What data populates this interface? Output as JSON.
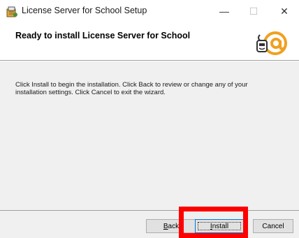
{
  "window": {
    "title": "License Server for School Setup",
    "minimize_glyph": "—",
    "maximize_glyph": "☐",
    "close_glyph": "✕"
  },
  "header": {
    "heading": "Ready to install License Server for School",
    "logo_icon": "at-sign-logo-icon"
  },
  "body": {
    "description": "Click Install to begin the installation. Click Back to review or change any of your installation settings. Click Cancel to exit the wizard."
  },
  "footer": {
    "back_label": "Back",
    "install_label": "Install",
    "cancel_label": "Cancel"
  },
  "overlay": {
    "highlight_color": "#ff0000",
    "highlight_target": "install-button"
  }
}
